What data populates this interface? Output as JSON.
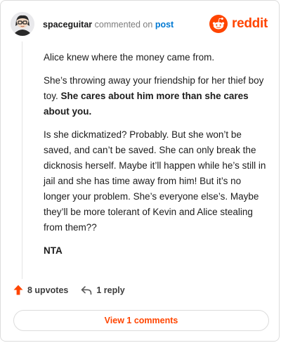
{
  "colors": {
    "brand": "#ff4500",
    "link": "#0079d3",
    "text": "#1c1c1c",
    "muted": "#7c7c7c",
    "border": "#dcdcdc"
  },
  "header": {
    "username": "spaceguitar",
    "action": "commented on",
    "post_link": "post",
    "brand": "reddit"
  },
  "comment": {
    "p1": "Alice knew where the money came from.",
    "p2_normal": "She’s throwing away your friendship for her thief boy toy.",
    "p2_bold": "She cares about him more than she cares about you.",
    "p3": "Is she dickmatized? Probably. But she won’t be saved, and can’t be saved. She can only break the dicknosis herself. Maybe it’ll happen while he’s still in jail and she has time away from him! But it’s no longer your problem. She’s everyone else’s. Maybe they’ll be more tolerant of Kevin and Alice stealing from them??",
    "p4_bold": "NTA"
  },
  "actions": {
    "upvotes": "8 upvotes",
    "reply": "1 reply"
  },
  "footer": {
    "view_comments": "View 1 comments"
  },
  "icons": {
    "avatar": "avatar",
    "brand": "reddit-snoo-icon",
    "upvote": "upvote-arrow-icon",
    "reply": "reply-arrow-icon"
  }
}
